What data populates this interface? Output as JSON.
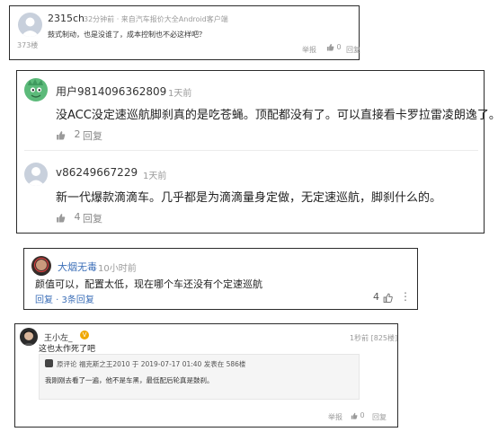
{
  "colors": {
    "link_blue": "#3c6fb8",
    "muted": "#9a9a9a",
    "vip_gold": "#f0a800",
    "avatar_green": "#5cba7a",
    "avatar_gray": "#c8d0dc"
  },
  "comments": [
    {
      "user": "2315ch",
      "meta": "32分钟前 · 来自汽车报价大全Android客户端",
      "floor": "373楼",
      "text": "鼓式制动，也是没谁了，成本控制也不必这样吧？",
      "report": "举报",
      "likes": "0",
      "reply": "回复"
    },
    {
      "user": "用户9814096362809",
      "time": "1天前",
      "text": "没ACC没定速巡航脚刹真的是吃苍蝇。顶配都没有了。可以直接看卡罗拉雷凌朗逸了。",
      "likes": "2",
      "reply": "回复"
    },
    {
      "user": "v86249667229",
      "time": "1天前",
      "text": "新一代爆款滴滴车。几乎都是为滴滴量身定做，无定速巡航，脚刹什么的。",
      "likes": "4",
      "reply": "回复"
    },
    {
      "user": "大烟无毒",
      "time": "10小时前",
      "text": "颜值可以，配置太低，现在哪个车还没有个定速巡航",
      "reply_link": "回复 · 3条回复",
      "likes": "4"
    },
    {
      "user": "王小左_",
      "time_floor": "1秒前 [825楼]",
      "text": "这也太作死了吧",
      "quote_header": "原评论  福克斯之王2010  于 2019-07-17 01:40 发表在  586楼",
      "quote_text": "我刚刚去看了一遍，他不是车黑，最低配后轮真是鼓刹。",
      "report": "举报",
      "likes": "0",
      "reply": "回复"
    }
  ]
}
